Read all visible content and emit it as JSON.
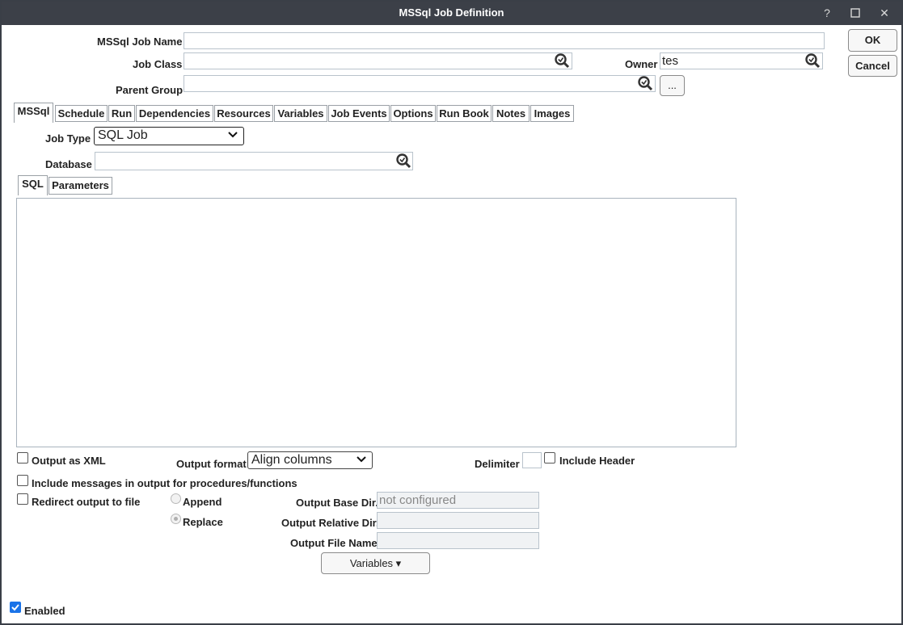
{
  "window": {
    "title": "MSSql Job Definition",
    "help_label": "?",
    "close_label": "✕"
  },
  "header": {
    "job_name_label": "MSSql Job Name",
    "job_name_value": "",
    "job_class_label": "Job Class",
    "job_class_value": "",
    "owner_label": "Owner",
    "owner_value": "tes",
    "parent_group_label": "Parent Group",
    "parent_group_value": "",
    "browse_label": "..."
  },
  "actions": {
    "ok_label": "OK",
    "cancel_label": "Cancel"
  },
  "tabs": [
    {
      "label": "MSSql",
      "active": true
    },
    {
      "label": "Schedule"
    },
    {
      "label": "Run"
    },
    {
      "label": "Dependencies"
    },
    {
      "label": "Resources"
    },
    {
      "label": "Variables"
    },
    {
      "label": "Job Events"
    },
    {
      "label": "Options"
    },
    {
      "label": "Run Book"
    },
    {
      "label": "Notes"
    },
    {
      "label": "Images"
    }
  ],
  "mssql": {
    "job_type_label": "Job Type",
    "job_type_value": "SQL Job",
    "database_label": "Database",
    "database_value": "",
    "subtabs": [
      {
        "label": "SQL",
        "active": true
      },
      {
        "label": "Parameters"
      }
    ],
    "sql_text": ""
  },
  "output": {
    "output_xml_label": "Output as XML",
    "output_xml_checked": false,
    "output_format_label": "Output format",
    "output_format_value": "Align columns",
    "delimiter_label": "Delimiter",
    "delimiter_value": "",
    "include_header_label": "Include Header",
    "include_header_checked": false,
    "include_messages_label": "Include messages in output for procedures/functions",
    "include_messages_checked": false,
    "redirect_label": "Redirect output to file",
    "redirect_checked": false,
    "append_label": "Append",
    "replace_label": "Replace",
    "replace_selected": true,
    "base_dir_label": "Output Base Dir.",
    "base_dir_value": "not configured",
    "relative_dir_label": "Output Relative Dir.",
    "relative_dir_value": "",
    "file_name_label": "Output File Name",
    "file_name_value": "",
    "variables_button_label": "Variables ▾"
  },
  "footer": {
    "enabled_label": "Enabled",
    "enabled_checked": true
  },
  "colors": {
    "titlebar": "#3c4048",
    "checkbox_checked": "#1a73e8"
  }
}
